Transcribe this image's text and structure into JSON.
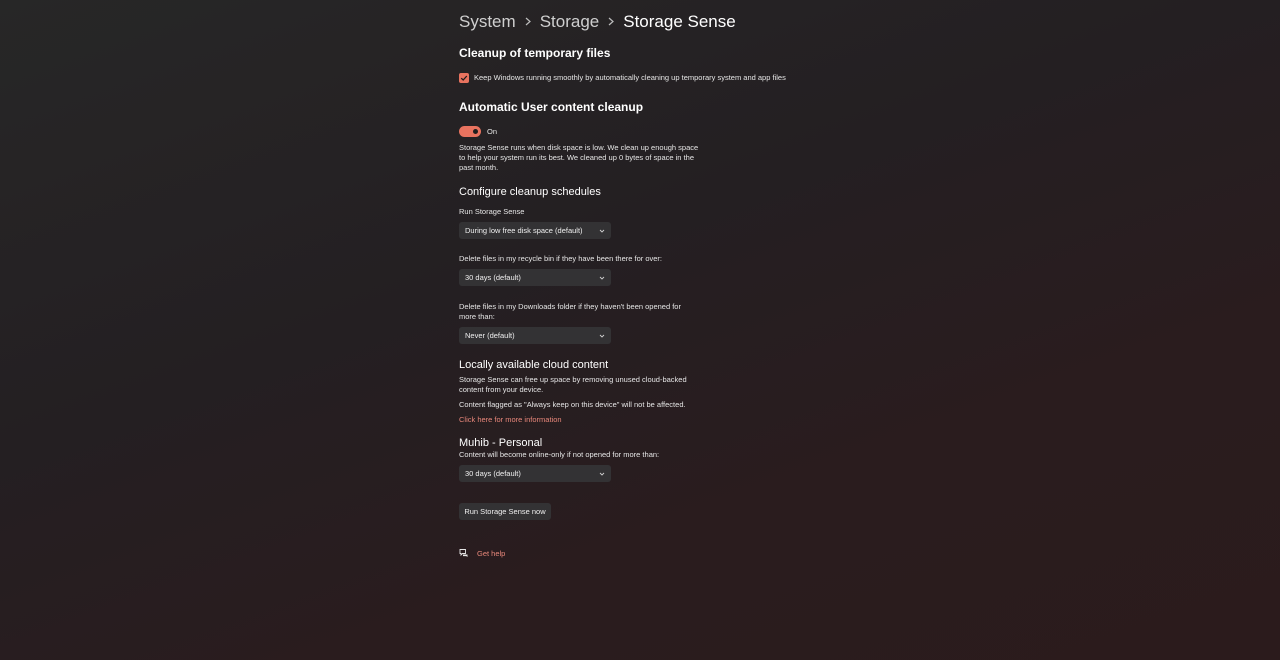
{
  "breadcrumb": {
    "items": [
      "System",
      "Storage"
    ],
    "current": "Storage Sense"
  },
  "temp_files": {
    "title": "Cleanup of temporary files",
    "checkbox_label": "Keep Windows running smoothly by automatically cleaning up temporary system and app files",
    "checked": true
  },
  "auto_cleanup": {
    "title": "Automatic User content cleanup",
    "toggle_label": "On",
    "toggle_on": true,
    "description": "Storage Sense runs when disk space is low. We clean up enough space to help your system run its best. We cleaned up 0 bytes of space in the past month."
  },
  "schedules": {
    "title": "Configure cleanup schedules",
    "run_label": "Run Storage Sense",
    "run_value": "During low free disk space (default)",
    "recycle_label": "Delete files in my recycle bin if they have been there for over:",
    "recycle_value": "30 days (default)",
    "downloads_label": "Delete files in my Downloads folder if they haven't been opened for more than:",
    "downloads_value": "Never (default)"
  },
  "cloud": {
    "title": "Locally available cloud content",
    "description": "Storage Sense can free up space by removing unused cloud-backed content from your device.",
    "note": "Content flagged as \"Always keep on this device\" will not be affected.",
    "link": "Click here for more information",
    "account_title": "Muhib - Personal",
    "account_label": "Content will become online-only if not opened for more than:",
    "account_value": "30 days (default)"
  },
  "actions": {
    "run_now": "Run Storage Sense now",
    "get_help": "Get help"
  },
  "colors": {
    "accent": "#e8735f",
    "link": "#e8877a",
    "control_bg": "#333234"
  },
  "icons": {
    "chevron": "chevron-down-icon",
    "help": "help-chat-icon",
    "check": "checkmark-icon"
  }
}
